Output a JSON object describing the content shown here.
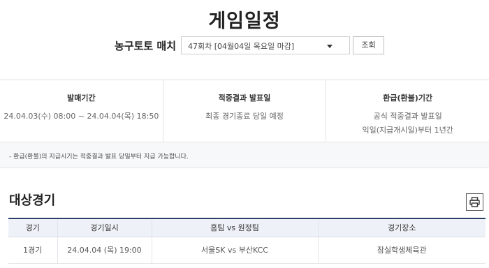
{
  "page": {
    "title": "게임일정"
  },
  "match_selector": {
    "label": "농구토토 매치",
    "selected": "47회차 [04월04일 목요일 마감]",
    "search_label": "조회"
  },
  "info": [
    {
      "title": "발매기간",
      "lines": [
        "24.04.03(수) 08:00 ~ 24.04.04(목) 18:50"
      ]
    },
    {
      "title": "적중결과 발표일",
      "lines": [
        "최종 경기종료 당일 예정"
      ]
    },
    {
      "title": "환급(환불)기간",
      "lines": [
        "공식 적중결과 발표일",
        "익일(지급개시일)부터 1년간"
      ]
    }
  ],
  "notice": "- 환급(환불)의 지급시기는 적중결과 발표 당일부터 지급 가능합니다.",
  "games_section": {
    "title": "대상경기",
    "print_icon": "printer-icon",
    "columns": [
      "경기",
      "경기일시",
      "홈팀  vs  원정팀",
      "경기장소"
    ],
    "rows": [
      {
        "game": "1경기",
        "datetime": "24.04.04 (목) 19:00",
        "teams": "서울SK  vs  부산KCC",
        "venue": "잠실학생체육관"
      }
    ]
  },
  "colors": {
    "table_header_bg": "#eef2f8",
    "table_top_border": "#2c3e63",
    "notice_bg": "#f7f8fa"
  }
}
